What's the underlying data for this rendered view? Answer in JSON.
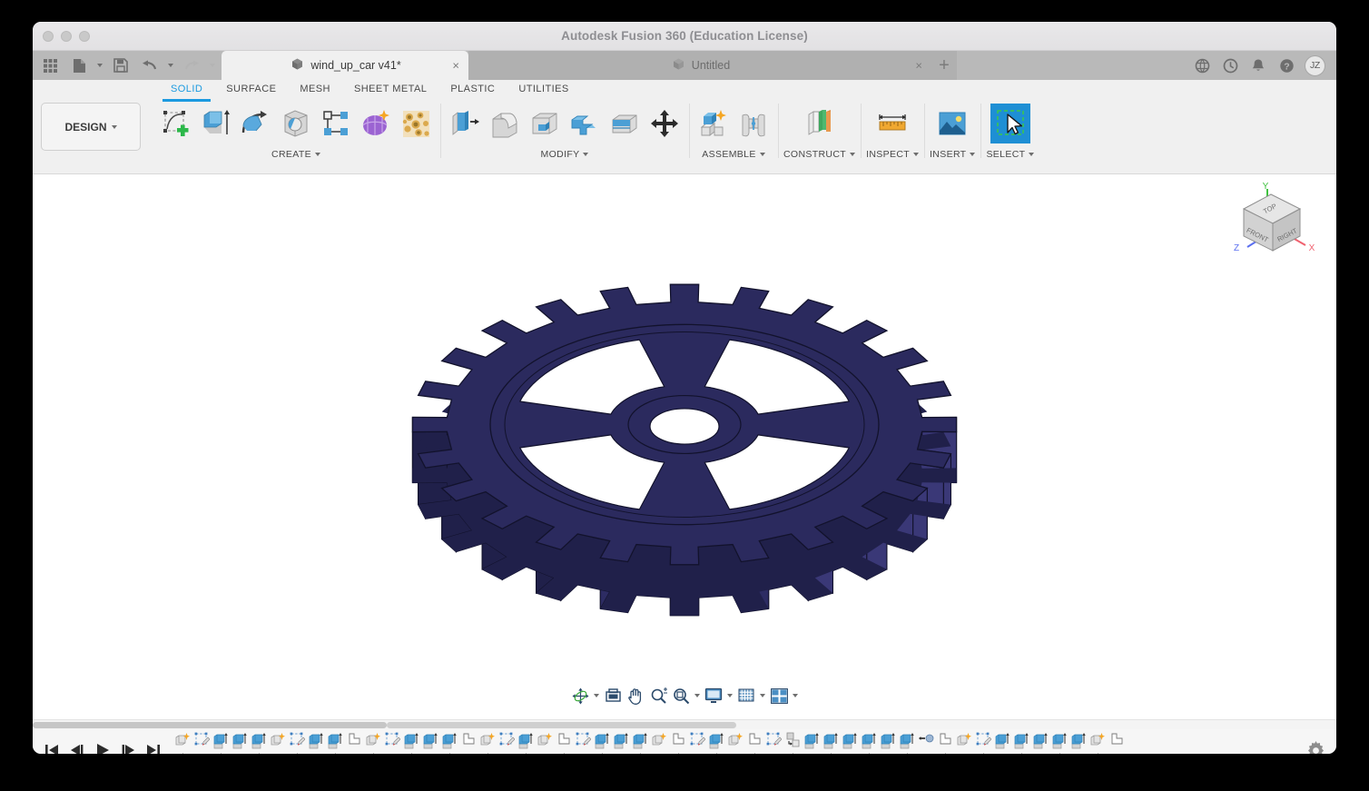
{
  "window": {
    "title": "Autodesk Fusion 360 (Education License)",
    "traffic_lights": [
      "close",
      "minimize",
      "maximize"
    ]
  },
  "quick_access": {
    "items": [
      {
        "name": "app-grid-icon",
        "label": "Show Data Panel"
      },
      {
        "name": "file-icon",
        "label": "File"
      },
      {
        "name": "save-icon",
        "label": "Save"
      },
      {
        "name": "undo-icon",
        "label": "Undo"
      },
      {
        "name": "redo-icon",
        "label": "Redo"
      }
    ]
  },
  "tabs": {
    "active": {
      "label": "wind_up_car v41*",
      "close": "×",
      "icon": "cube-icon"
    },
    "inactive": {
      "label": "Untitled",
      "close": "×",
      "icon": "cube-icon"
    },
    "new_tab": "+"
  },
  "tabbar_right": {
    "items": [
      {
        "name": "globe-icon",
        "label": "Community"
      },
      {
        "name": "clock-icon",
        "label": "Job Status"
      },
      {
        "name": "bell-icon",
        "label": "Notifications"
      },
      {
        "name": "help-icon",
        "label": "Help"
      }
    ],
    "avatar": "JZ"
  },
  "workspace": {
    "label": "DESIGN"
  },
  "ribbon": {
    "tabs": [
      {
        "label": "SOLID",
        "active": true
      },
      {
        "label": "SURFACE",
        "active": false
      },
      {
        "label": "MESH",
        "active": false
      },
      {
        "label": "SHEET METAL",
        "active": false
      },
      {
        "label": "PLASTIC",
        "active": false
      },
      {
        "label": "UTILITIES",
        "active": false
      }
    ],
    "panels": [
      {
        "label": "CREATE",
        "has_caret": true,
        "tools": [
          {
            "name": "create-sketch-icon",
            "label": "Create Sketch"
          },
          {
            "name": "extrude-icon",
            "label": "Extrude"
          },
          {
            "name": "revolve-icon",
            "label": "Revolve"
          },
          {
            "name": "sweep-icon",
            "label": "Sweep"
          },
          {
            "name": "pattern-icon",
            "label": "Pattern"
          },
          {
            "name": "create-form-icon",
            "label": "Create Form"
          },
          {
            "name": "create-mesh-icon",
            "label": "Create Mesh"
          }
        ]
      },
      {
        "label": "MODIFY",
        "has_caret": true,
        "tools": [
          {
            "name": "press-pull-icon",
            "label": "Press Pull"
          },
          {
            "name": "fillet-icon",
            "label": "Fillet"
          },
          {
            "name": "shell-icon",
            "label": "Shell"
          },
          {
            "name": "combine-icon",
            "label": "Combine"
          },
          {
            "name": "split-face-icon",
            "label": "Split Face"
          },
          {
            "name": "move-copy-icon",
            "label": "Move/Copy"
          }
        ]
      },
      {
        "label": "ASSEMBLE",
        "has_caret": true,
        "tools": [
          {
            "name": "new-component-icon",
            "label": "New Component"
          },
          {
            "name": "joint-icon",
            "label": "Joint"
          }
        ]
      },
      {
        "label": "CONSTRUCT",
        "has_caret": true,
        "tools": [
          {
            "name": "construct-plane-icon",
            "label": "Offset Plane"
          }
        ]
      },
      {
        "label": "INSPECT",
        "has_caret": true,
        "tools": [
          {
            "name": "measure-icon",
            "label": "Measure"
          }
        ]
      },
      {
        "label": "INSERT",
        "has_caret": true,
        "tools": [
          {
            "name": "insert-image-icon",
            "label": "Decal"
          }
        ]
      },
      {
        "label": "SELECT",
        "has_caret": true,
        "selected": true,
        "tools": [
          {
            "name": "select-icon",
            "label": "Select"
          }
        ]
      }
    ]
  },
  "viewcube": {
    "faces": {
      "top": "TOP",
      "front": "FRONT",
      "right": "RIGHT"
    },
    "axes": [
      {
        "label": "Y",
        "color": "#3fc23f"
      },
      {
        "label": "X",
        "color": "#f0616f"
      },
      {
        "label": "Z",
        "color": "#5b6ff0"
      }
    ]
  },
  "canvas": {
    "background": "#ffffff",
    "model": {
      "name": "spur-gear",
      "teeth": 24,
      "body_color": "#2b2a5e",
      "shade_dark": "#20204a",
      "shade_mid": "#2d2c63",
      "shade_light": "#3a3877",
      "edge_color": "#12122c",
      "spokes": 4
    }
  },
  "nav_bar": {
    "items": [
      {
        "name": "orbit-icon",
        "label": "Orbit",
        "caret": true
      },
      {
        "name": "look-at-icon",
        "label": "Look At",
        "caret": false
      },
      {
        "name": "pan-icon",
        "label": "Pan",
        "caret": false
      },
      {
        "name": "zoom-icon",
        "label": "Zoom",
        "caret": false
      },
      {
        "name": "zoom-window-icon",
        "label": "Fit",
        "caret": true
      },
      {
        "name": "display-settings-icon",
        "label": "Display Settings",
        "caret": true
      },
      {
        "name": "grid-settings-icon",
        "label": "Grid and Snaps",
        "caret": true
      },
      {
        "name": "viewports-icon",
        "label": "Viewports",
        "caret": true
      }
    ]
  },
  "timeline": {
    "playback": [
      {
        "name": "go-to-beginning-icon",
        "label": "Go to Beginning"
      },
      {
        "name": "step-back-icon",
        "label": "Step Back"
      },
      {
        "name": "play-icon",
        "label": "Play Playback"
      },
      {
        "name": "step-forward-icon",
        "label": "Step Forward"
      },
      {
        "name": "go-to-end-icon",
        "label": "Go to End"
      }
    ],
    "settings_icon": "gear-icon",
    "overflow": "...",
    "nodes": [
      "new-component",
      "sketch",
      "extrude",
      "extrude",
      "extrude",
      "new-component",
      "sketch",
      "extrude",
      "extrude",
      "fillet",
      "new-component",
      "sketch",
      "extrude",
      "extrude",
      "extrude",
      "fillet",
      "new-component",
      "sketch",
      "extrude",
      "new-component",
      "fillet",
      "sketch",
      "extrude",
      "extrude",
      "extrude",
      "new-component",
      "fillet",
      "sketch",
      "extrude",
      "new-component",
      "fillet",
      "sketch",
      "move-copy",
      "extrude",
      "extrude",
      "extrude",
      "extrude",
      "extrude",
      "extrude",
      "joint",
      "fillet",
      "new-component",
      "sketch",
      "extrude",
      "extrude",
      "extrude",
      "extrude",
      "extrude",
      "new-component",
      "fillet"
    ]
  }
}
